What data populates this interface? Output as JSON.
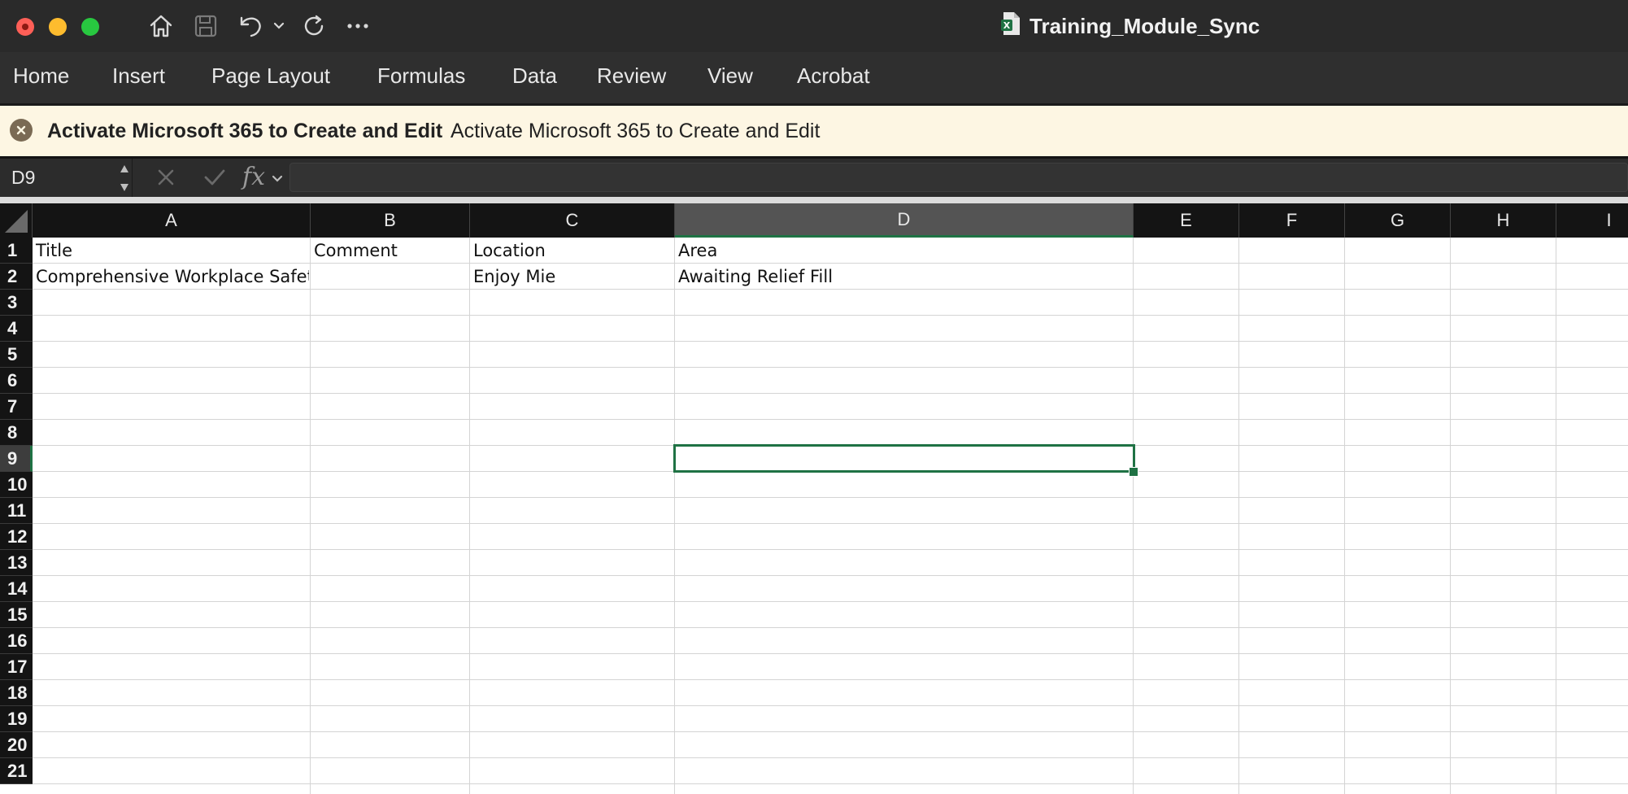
{
  "window": {
    "title": "Training_Module_Sync",
    "icons": [
      "home-icon",
      "save-icon",
      "undo-icon",
      "chevron-down-icon",
      "redo-icon",
      "more-icon",
      "excel-file-icon"
    ]
  },
  "ribbon": {
    "tabs": [
      "Home",
      "Insert",
      "Page Layout",
      "Formulas",
      "Data",
      "Review",
      "View",
      "Acrobat"
    ]
  },
  "message_bar": {
    "title": "Activate Microsoft 365 to Create and Edit",
    "text": "Activate Microsoft 365 to Create and Edit",
    "icon": "close-circle-icon"
  },
  "formula_bar": {
    "name_box": "D9",
    "fx_label": "fx",
    "value": ""
  },
  "sheet": {
    "columns": [
      "A",
      "B",
      "C",
      "D",
      "E",
      "F",
      "G",
      "H",
      "I"
    ],
    "selected_column": "D",
    "rows": [
      "1",
      "2",
      "3",
      "4",
      "5",
      "6",
      "7",
      "8",
      "9",
      "10",
      "11",
      "12",
      "13",
      "14",
      "15",
      "16",
      "17",
      "18",
      "19",
      "20",
      "21"
    ],
    "selected_row": "9",
    "selected_cell": "D9",
    "cells": {
      "A1": "Title",
      "B1": "Comment",
      "C1": "Location",
      "D1": "Area",
      "A2": "Comprehensive Workplace Safety",
      "C2": "Enjoy Mie",
      "D2": "Awaiting Relief Fill"
    }
  },
  "colors": {
    "accent": "#1f7244",
    "titlebar": "#2a2a2a",
    "message_bar": "#fdf6e3"
  }
}
